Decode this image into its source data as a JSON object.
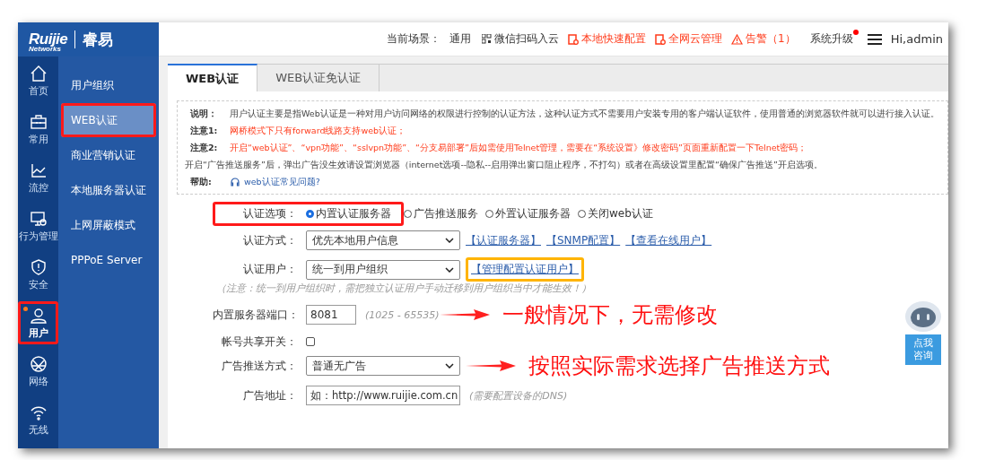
{
  "brand": {
    "logo": "Ruijie",
    "sub": "Networks",
    "product": "睿易"
  },
  "header": {
    "scene_label": "当前场景：",
    "scene": "通用",
    "actions": [
      {
        "label": "微信扫码入云",
        "kind": "plain"
      },
      {
        "label": "本地快速配置",
        "kind": "alert"
      },
      {
        "label": "全网云管理",
        "kind": "alert"
      },
      {
        "label": "告警（1）",
        "kind": "warning"
      }
    ],
    "upgrade": {
      "label": "系统升级",
      "badge": true
    },
    "user": "Hi,admin"
  },
  "nav": [
    {
      "label": "首页",
      "selected": false,
      "dot": false,
      "highlighted": false
    },
    {
      "label": "常用",
      "selected": false,
      "dot": false,
      "highlighted": false
    },
    {
      "label": "流控",
      "selected": false,
      "dot": false,
      "highlighted": false
    },
    {
      "label": "行为管理",
      "selected": false,
      "dot": false,
      "highlighted": false
    },
    {
      "label": "安全",
      "selected": false,
      "dot": false,
      "highlighted": false
    },
    {
      "label": "用户",
      "selected": true,
      "dot": true,
      "highlighted": true
    },
    {
      "label": "网络",
      "selected": false,
      "dot": false,
      "highlighted": false
    },
    {
      "label": "无线",
      "selected": false,
      "dot": false,
      "highlighted": false
    }
  ],
  "submenu": [
    {
      "label": "用户组织",
      "selected": false,
      "highlighted": false
    },
    {
      "label": "WEB认证",
      "selected": true,
      "highlighted": true
    },
    {
      "label": "商业营销认证",
      "selected": false,
      "highlighted": false
    },
    {
      "label": "本地服务器认证",
      "selected": false,
      "highlighted": false
    },
    {
      "label": "上网屏蔽模式",
      "selected": false,
      "highlighted": false
    },
    {
      "label": "PPPoE Server",
      "selected": false,
      "highlighted": false
    }
  ],
  "tabs": [
    {
      "label": "WEB认证",
      "selected": true
    },
    {
      "label": "WEB认证免认证",
      "selected": false
    }
  ],
  "info": [
    {
      "label": "说明：",
      "text": "用户认证主要是指Web认证是一种对用户访问网络的权限进行控制的认证方法，这种认证方式不需要用户安装专用的客户端认证软件，使用普通的浏览器软件就可以进行接入认证。",
      "kind": "normal"
    },
    {
      "label": "注意1:",
      "text": "网桥模式下只有forward线路支持web认证；",
      "kind": "warning"
    },
    {
      "label": "注意2:",
      "text": "开启“web认证”、“vpn功能”、“sslvpn功能”、“分支易部署”后如需使用Telnet管理，需要在“系统设置》修改密码”页面重新配置一下Telnet密码；",
      "kind": "warning"
    },
    {
      "text": "开启“广告推送服务”后，弹出广告没生效请设置浏览器（internet选项--隐私--启用弹出窗口阻止程序，不打勾）或者在高级设置里配置“确保广告推送”开启选项。",
      "kind": "plain"
    },
    {
      "label": "帮助:",
      "text": "web认证常见问题?",
      "kind": "link"
    }
  ],
  "form": [
    {
      "kind": "radio",
      "label": "认证选项：",
      "highlighted": true,
      "options": [
        {
          "label": "内置认证服务器",
          "selected": true
        },
        {
          "label": "广告推送服务",
          "selected": false
        },
        {
          "label": "外置认证服务器",
          "selected": false
        },
        {
          "label": "关闭web认证",
          "selected": false
        }
      ]
    },
    {
      "kind": "select",
      "label": "认证方式：",
      "value": "优先本地用户信息",
      "links": [
        {
          "text": "【认证服务器】",
          "highlighted": false
        },
        {
          "text": "【SNMP配置】",
          "highlighted": false
        },
        {
          "text": "【查看在线用户】",
          "highlighted": false
        }
      ]
    },
    {
      "kind": "select",
      "label": "认证用户：",
      "value": "统一到用户组织",
      "links": [
        {
          "text": "【管理配置认证用户】",
          "highlighted": true
        }
      ],
      "note": "（注意：统一到用户组织时，需把独立认证用户手动迁移到用户组织当中才能生效！）"
    },
    {
      "kind": "input",
      "label": "内置服务器端口：",
      "value": "8081",
      "note": "(1025 - 65535)",
      "annotation": "一般情况下，无需修改"
    },
    {
      "kind": "checkbox",
      "label": "帐号共享开关：",
      "checked": false
    },
    {
      "kind": "select",
      "label": "广告推送方式：",
      "value": "普通无广告",
      "annotation": "按照实际需求选择广告推送方式"
    },
    {
      "kind": "wide-input",
      "label": "广告地址：",
      "value": "如：http://www.ruijie.com.cn",
      "note": "(需要配置设备的DNS)"
    }
  ],
  "assistant": {
    "label": "点我咨询"
  }
}
